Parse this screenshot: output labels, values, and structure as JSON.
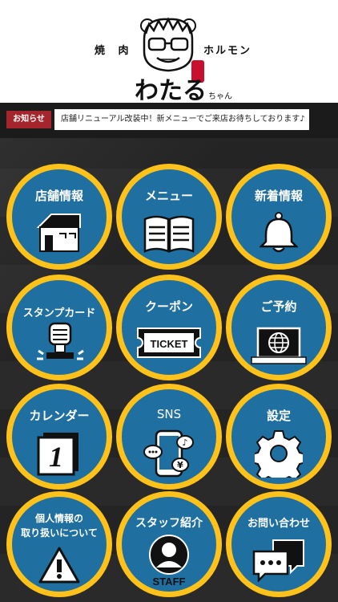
{
  "header": {
    "logo_left": "焼 肉",
    "logo_right": "ホルモン",
    "logo_name": "わたる",
    "logo_suffix": "ちゃん"
  },
  "news": {
    "label": "お知らせ",
    "message": "店舗リニューアル改装中！新メニューでご来店お待ちしております♪"
  },
  "tiles": [
    {
      "label": "店舗情報",
      "icon": "house-icon"
    },
    {
      "label": "メニュー",
      "icon": "open-book-icon"
    },
    {
      "label": "新着情報",
      "icon": "bell-icon"
    },
    {
      "label": "スタンプカード",
      "icon": "stamp-icon"
    },
    {
      "label": "クーポン",
      "icon": "ticket-icon",
      "icon_text": "TICKET"
    },
    {
      "label": "ご予約",
      "icon": "laptop-globe-icon"
    },
    {
      "label": "カレンダー",
      "icon": "calendar-icon",
      "icon_text": "1"
    },
    {
      "label": "SNS",
      "icon": "phone-chat-icon"
    },
    {
      "label": "設定",
      "icon": "gear-icon"
    },
    {
      "label": "個人情報の\n取り扱いについて",
      "icon": "warning-icon"
    },
    {
      "label": "スタッフ紹介",
      "icon": "staff-icon",
      "icon_text": "STAFF"
    },
    {
      "label": "お問い合わせ",
      "icon": "chat-bubbles-icon"
    }
  ],
  "colors": {
    "ring": "#ffc21a",
    "tile": "#1f6fa0",
    "news_label": "#a4262c"
  }
}
